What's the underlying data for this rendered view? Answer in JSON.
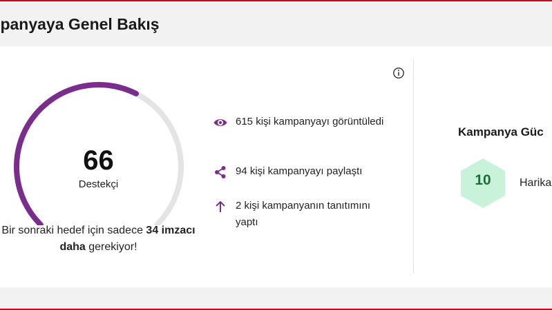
{
  "header": {
    "title": "mpanyaya Genel Bakış"
  },
  "gauge": {
    "value": "66",
    "label": "Destekçi",
    "progress": 0.6,
    "color": "#7b2d8e",
    "track_color": "#e4e4e4"
  },
  "goal": {
    "prefix": "Bir sonraki hedef için sadece ",
    "bold": "34 imzacı daha",
    "suffix": " gerekiyor!"
  },
  "stats": [
    {
      "icon": "eye-icon",
      "text": "615 kişi kampanyayı görüntüledi"
    },
    {
      "icon": "share-icon",
      "text": "94 kişi kampanyayı paylaştı"
    },
    {
      "icon": "arrow-up-icon",
      "text": "2 kişi kampanyanın tanıtımını yaptı"
    }
  ],
  "strength": {
    "title": "Kampanya Güc",
    "score": "10",
    "label": "Harika",
    "hex_color": "#c9f2da",
    "score_color": "#1e6b3a"
  },
  "colors": {
    "accent": "#7b2d8e",
    "rule": "#d0021b"
  }
}
